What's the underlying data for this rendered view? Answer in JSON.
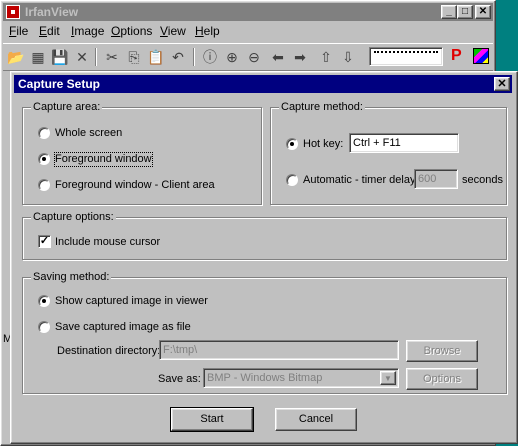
{
  "app": {
    "title": "IrfanView",
    "window_buttons": {
      "minimize": "_",
      "maximize": "□",
      "close": "✕"
    },
    "menu": [
      "File",
      "Edit",
      "Image",
      "Options",
      "View",
      "Help"
    ],
    "menu_access_keys": [
      "F",
      "E",
      "I",
      "O",
      "V",
      "H"
    ],
    "toolbar_icons": [
      "open-folder-icon",
      "slideshow-icon",
      "save-icon",
      "delete-icon",
      "cut-icon",
      "copy-icon",
      "paste-icon",
      "undo-icon",
      "info-icon",
      "zoom-in-icon",
      "zoom-out-icon",
      "previous-icon",
      "next-icon",
      "first-page-icon",
      "last-page-icon"
    ],
    "toolbar_glyphs": [
      "📂",
      "▦",
      "💾",
      "✕",
      "✂",
      "⎘",
      "📋",
      "↶",
      "ⓘ",
      "⊕",
      "⊖",
      "⬅",
      "➡",
      "⇧",
      "⇩"
    ],
    "p_label": "P",
    "status_stub": "M"
  },
  "dialog": {
    "title": "Capture Setup",
    "close_glyph": "✕",
    "capture_area": {
      "legend": "Capture area:",
      "options": [
        "Whole screen",
        "Foreground window",
        "Foreground window - Client area"
      ],
      "selected": 1
    },
    "capture_method": {
      "legend": "Capture method:",
      "hotkey_label": "Hot key:",
      "hotkey_value": "Ctrl + F11",
      "auto_label": "Automatic - timer delay:",
      "delay_value": "600",
      "delay_unit": "seconds",
      "selected": "hotkey"
    },
    "capture_options": {
      "legend": "Capture options:",
      "include_cursor_label": "Include mouse cursor",
      "include_cursor_checked": true
    },
    "saving_method": {
      "legend": "Saving method:",
      "show_label": "Show captured image in viewer",
      "save_label": "Save captured image as file",
      "selected": "show",
      "dest_label": "Destination directory:",
      "dest_value": "F:\\tmp\\",
      "browse_label": "Browse",
      "save_as_label": "Save as:",
      "save_as_value": "BMP - Windows Bitmap",
      "options_label": "Options"
    },
    "start_label": "Start",
    "cancel_label": "Cancel"
  },
  "colors": {
    "face": "#c0c0c0",
    "active_title": "#000080",
    "inactive_title": "#808080",
    "desktop": "#008080"
  }
}
